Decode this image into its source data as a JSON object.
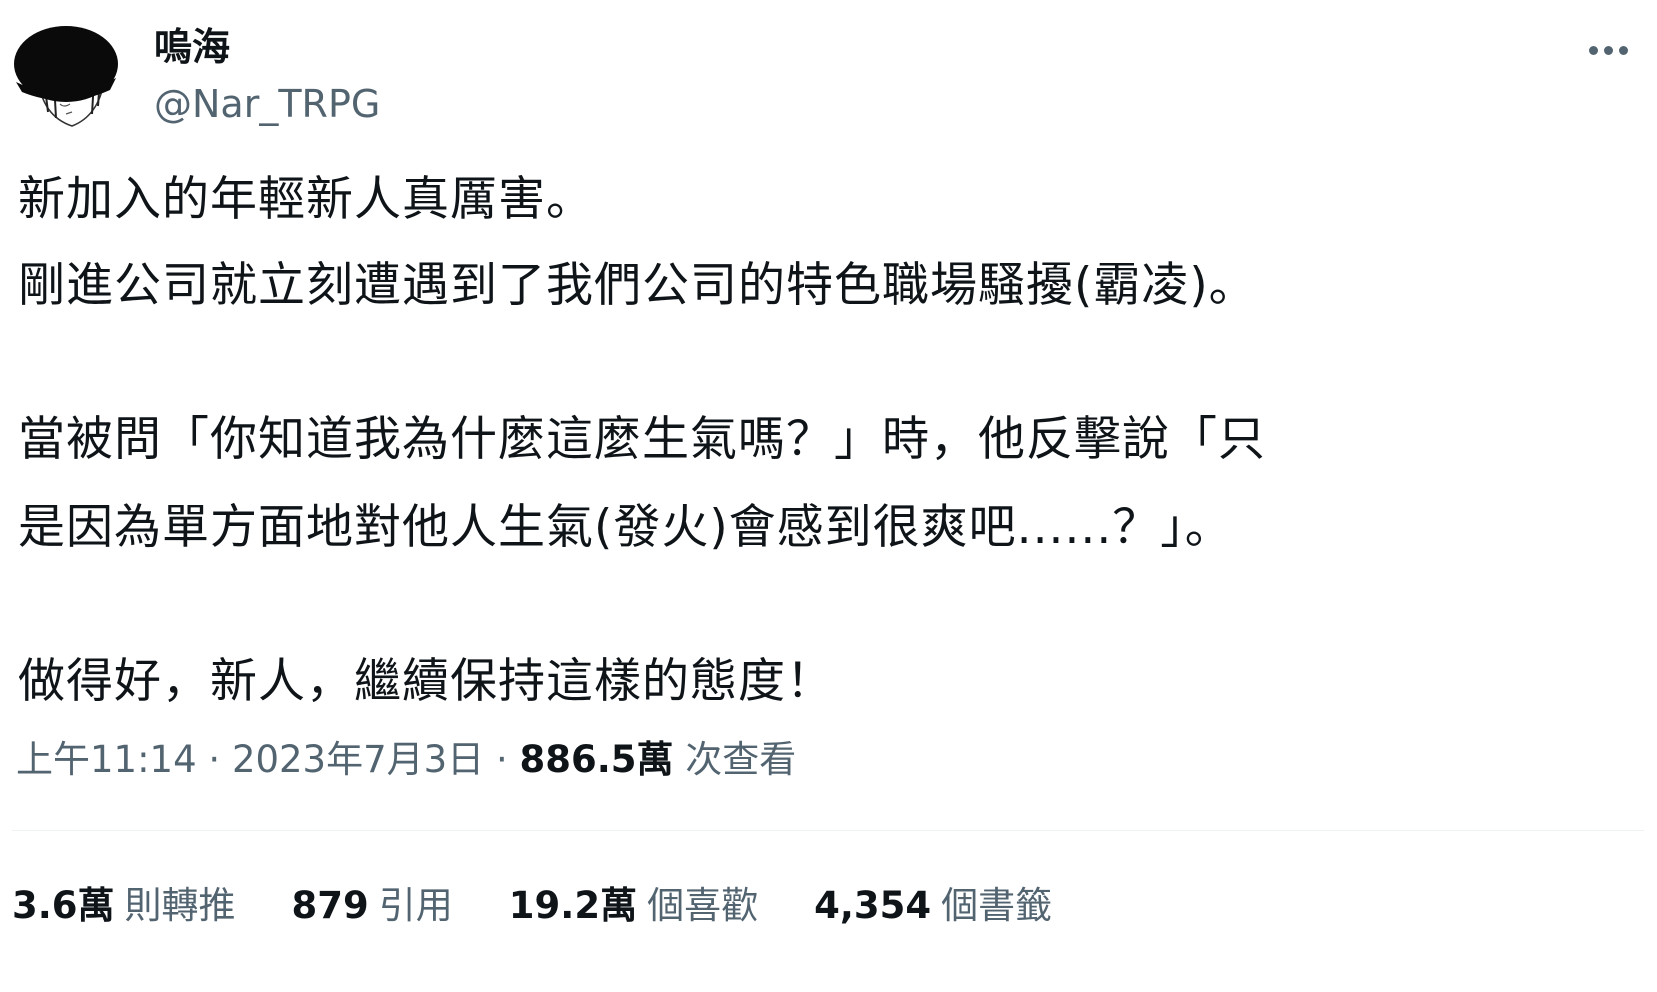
{
  "author": {
    "display_name": "嗚海",
    "handle": "@Nar_TRPG"
  },
  "more_icon": "more-horizontal-icon",
  "body": {
    "lines": [
      "新加入的年輕新人真厲害。",
      "剛進公司就立刻遭遇到了我們公司的特色職場騷擾(霸凌)。",
      "當被問「你知道我為什麼這麼生氣嗎？」時，他反擊說「只",
      "是因為單方面地對他人生氣(發火)會感到很爽吧......？」。",
      "做得好，新人，繼續保持這樣的態度！"
    ]
  },
  "meta": {
    "time": "上午11:14",
    "sep1": "·",
    "date": "2023年7月3日",
    "sep2": "·",
    "views": "886.5萬",
    "views_label": "次查看"
  },
  "stats": [
    {
      "value": "3.6萬",
      "label": "則轉推"
    },
    {
      "value": "879",
      "label": "引用"
    },
    {
      "value": "19.2萬",
      "label": "個喜歡"
    },
    {
      "value": "4,354",
      "label": "個書籤"
    }
  ],
  "colors": {
    "text_primary": "#0f1419",
    "text_secondary": "#536471",
    "divider": "#eff3f4",
    "background": "#ffffff"
  }
}
